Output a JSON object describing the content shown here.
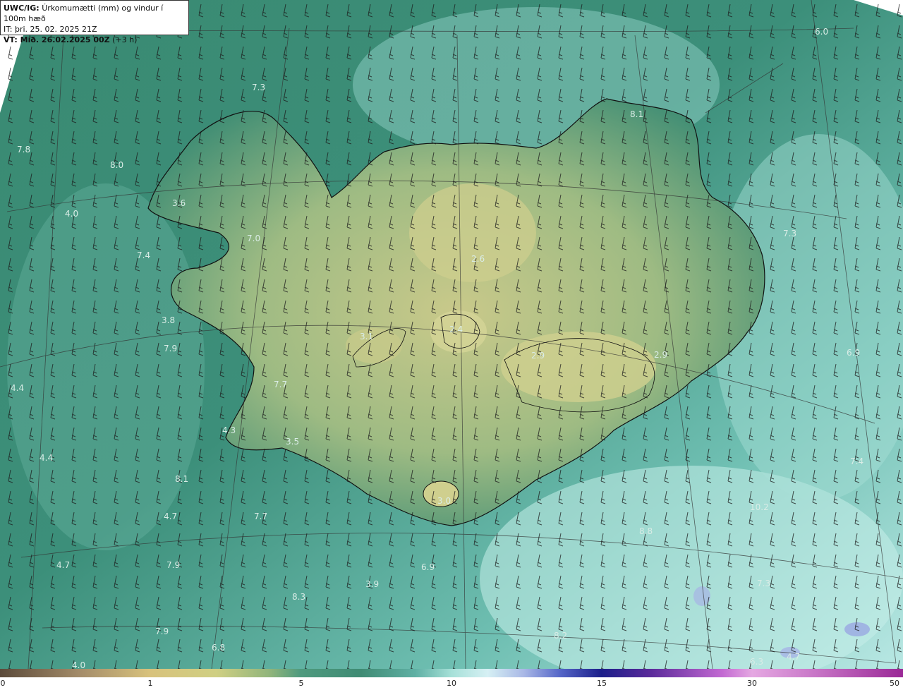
{
  "header": {
    "product": "UWC/IG:",
    "description": "Úrkomumætti (mm) og vindur í 100m hæð",
    "initial_time": "IT: þri. 25. 02. 2025 21Z",
    "valid_label": "VT: Mið. 26.02.2025 00Z",
    "valid_offset": "(+3 h)"
  },
  "map": {
    "colors": {
      "sea_dark": "#2f7f6a",
      "sea_light": "#9fd8d2",
      "land_dry": "#c9c98a",
      "coastline": "#111111",
      "gridline": "#333333",
      "barb": "#1a1a1a",
      "label": "#d9ece6"
    },
    "value_labels": [
      "7.3",
      "6.0",
      "8.1",
      "7.8",
      "8.0",
      "4.0",
      "3.6",
      "7.0",
      "7.4",
      "2.6",
      "7.3",
      "3.8",
      "3.1",
      "2.4",
      "7.9",
      "2.9",
      "2.9",
      "6.9",
      "4.4",
      "7.7",
      "4.3",
      "3.5",
      "4.4",
      "8.1",
      "3.0",
      "7.4",
      "4.7",
      "7.7",
      "10.2",
      "8.8",
      "4.7",
      "7.9",
      "6.9",
      "3.9",
      "7.3",
      "8.3",
      "7.9",
      "8.2",
      "6.8",
      "6.3",
      "4.0",
      "4.7"
    ]
  },
  "colorbar": {
    "ticks": [
      "0",
      "1",
      "5",
      "10",
      "15",
      "30",
      "50"
    ]
  }
}
